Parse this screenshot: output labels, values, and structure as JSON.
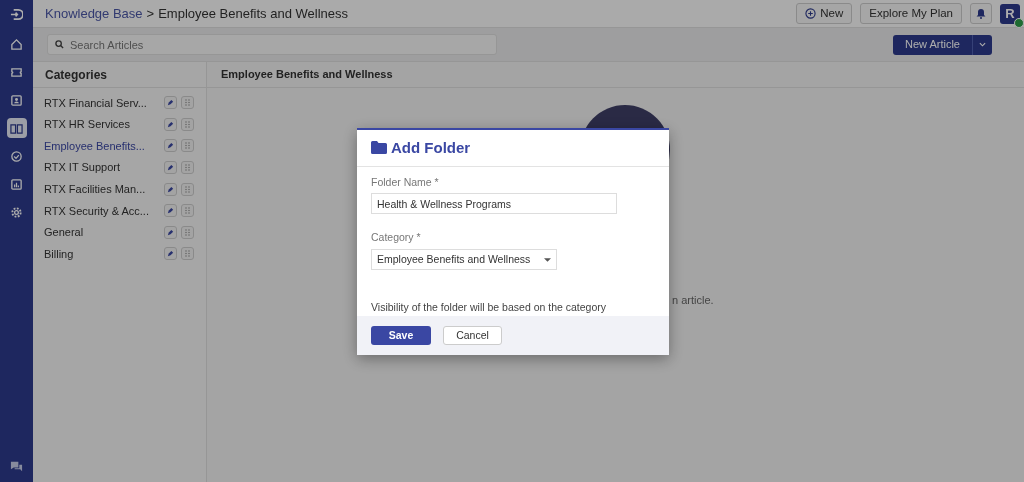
{
  "breadcrumb": {
    "link": "Knowledge Base",
    "separator": ">",
    "current": "Employee Benefits and Wellness"
  },
  "top_buttons": [
    {
      "label": "New",
      "kind": "new"
    },
    {
      "label": "Explore My Plan",
      "kind": "plain"
    }
  ],
  "avatar": {
    "initial": "R",
    "online": true
  },
  "nav": [
    {
      "kind": "home",
      "selected": false
    },
    {
      "kind": "ticket",
      "selected": false
    },
    {
      "kind": "contact",
      "selected": false
    },
    {
      "kind": "book",
      "selected": true
    },
    {
      "kind": "check",
      "selected": false
    },
    {
      "kind": "chart",
      "selected": false
    },
    {
      "kind": "gear",
      "selected": false
    }
  ],
  "search": {
    "placeholder": "Search Articles"
  },
  "new_article_button": "New Article",
  "categories": {
    "title": "Categories",
    "items": [
      {
        "label": "RTX Financial Serv...",
        "selected": false
      },
      {
        "label": "RTX HR Services",
        "selected": false
      },
      {
        "label": "Employee Benefits...",
        "selected": true
      },
      {
        "label": "RTX IT Support",
        "selected": false
      },
      {
        "label": "RTX Facilities Man...",
        "selected": false
      },
      {
        "label": "RTX Security & Acc...",
        "selected": false
      },
      {
        "label": "General",
        "selected": false
      },
      {
        "label": "Billing",
        "selected": false
      }
    ]
  },
  "main": {
    "title": "Employee Benefits and Wellness",
    "empty_text": "n article."
  },
  "modal": {
    "title": "Add Folder",
    "folder_name_label": "Folder Name *",
    "folder_name_value": "Health & Wellness Programs",
    "category_label": "Category *",
    "category_value": "Employee Benefits and Wellness",
    "note": "Visibility of the folder will be based on the category",
    "save": "Save",
    "cancel": "Cancel"
  }
}
